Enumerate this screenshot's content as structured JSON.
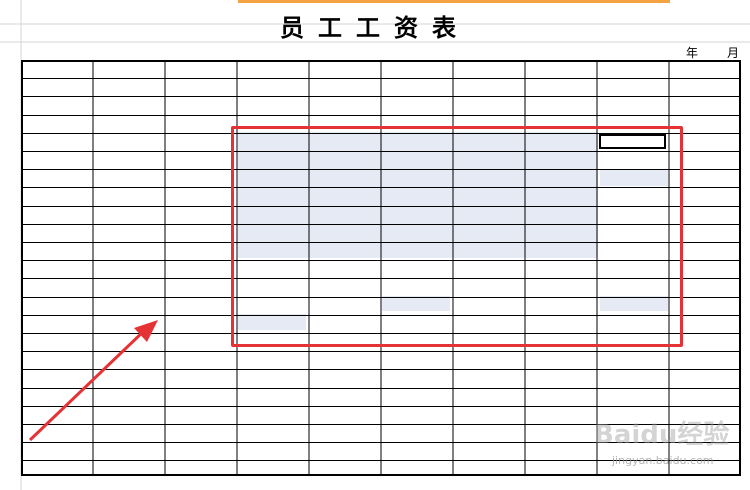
{
  "sheet": {
    "title": "员工工资表",
    "year_label": "年",
    "month_label": "月"
  },
  "watermark": {
    "brand": "Baidu经验",
    "url": "jingyan.baidu.com"
  },
  "colors": {
    "selection_border": "#e53335",
    "highlight_fill": "#e6eaf5",
    "arrow": "#e53335",
    "top_bar": "#f4a340"
  }
}
